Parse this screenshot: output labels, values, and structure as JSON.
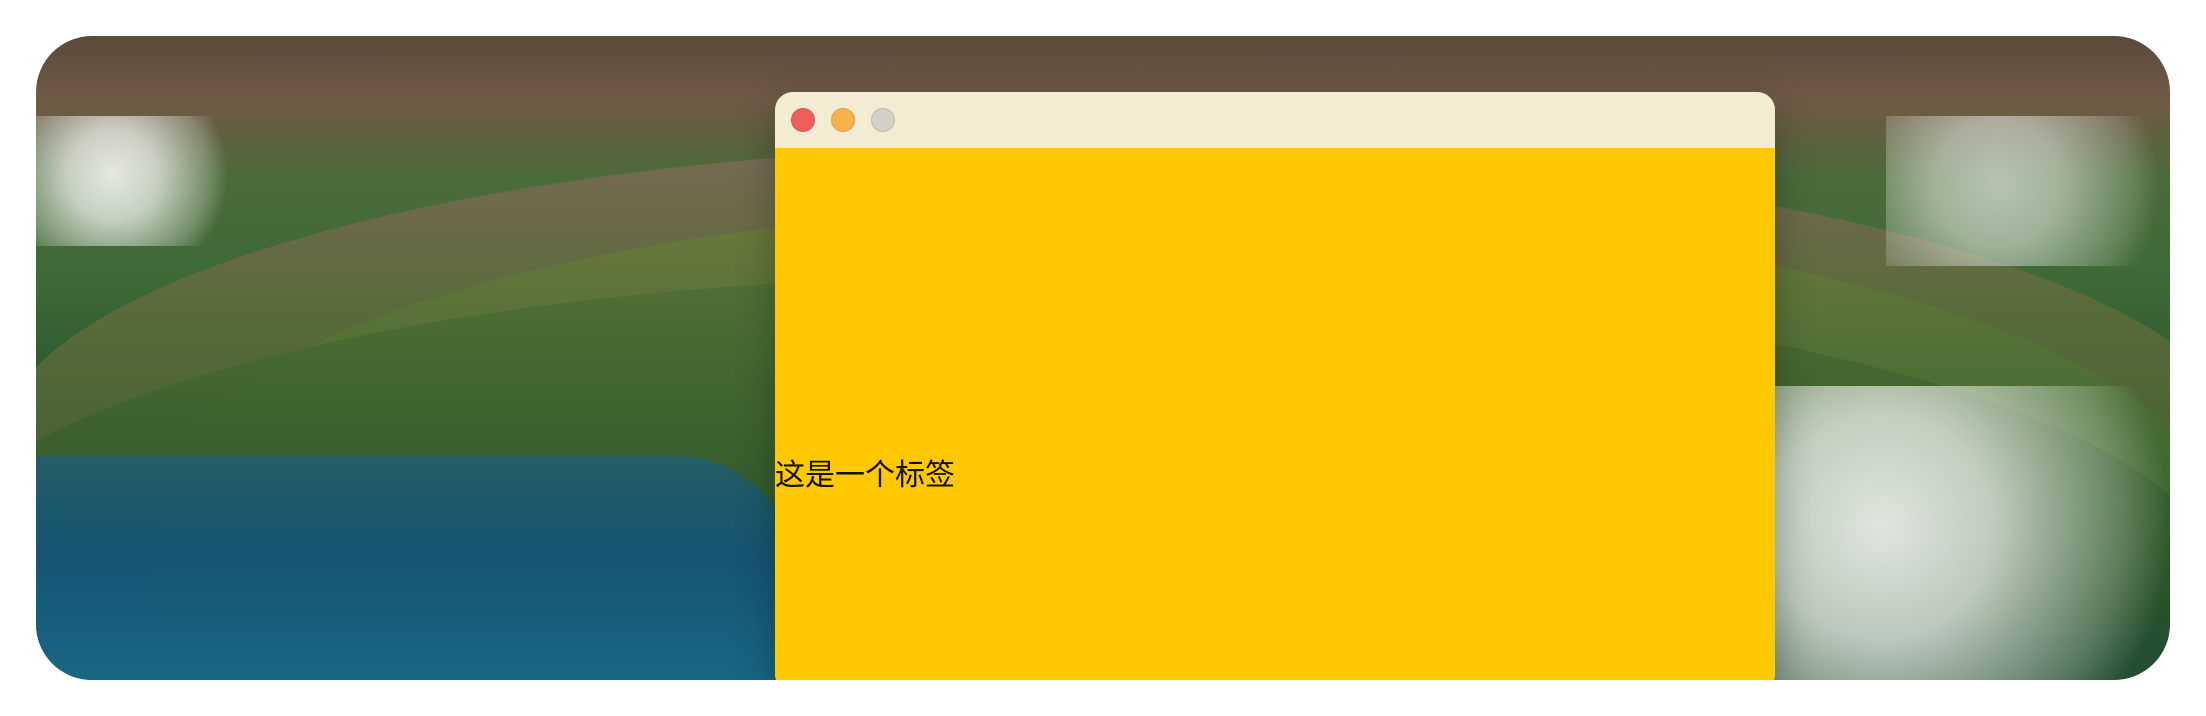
{
  "window": {
    "traffic_lights": [
      {
        "name": "close",
        "color": "#ee5f5b"
      },
      {
        "name": "minimize",
        "color": "#f5b14a"
      },
      {
        "name": "maximize",
        "color": "#d2d0c7"
      }
    ],
    "background_color": "#ffc800",
    "titlebar_color": "#f3ebd2"
  },
  "content": {
    "label_text": "这是一个标签"
  }
}
